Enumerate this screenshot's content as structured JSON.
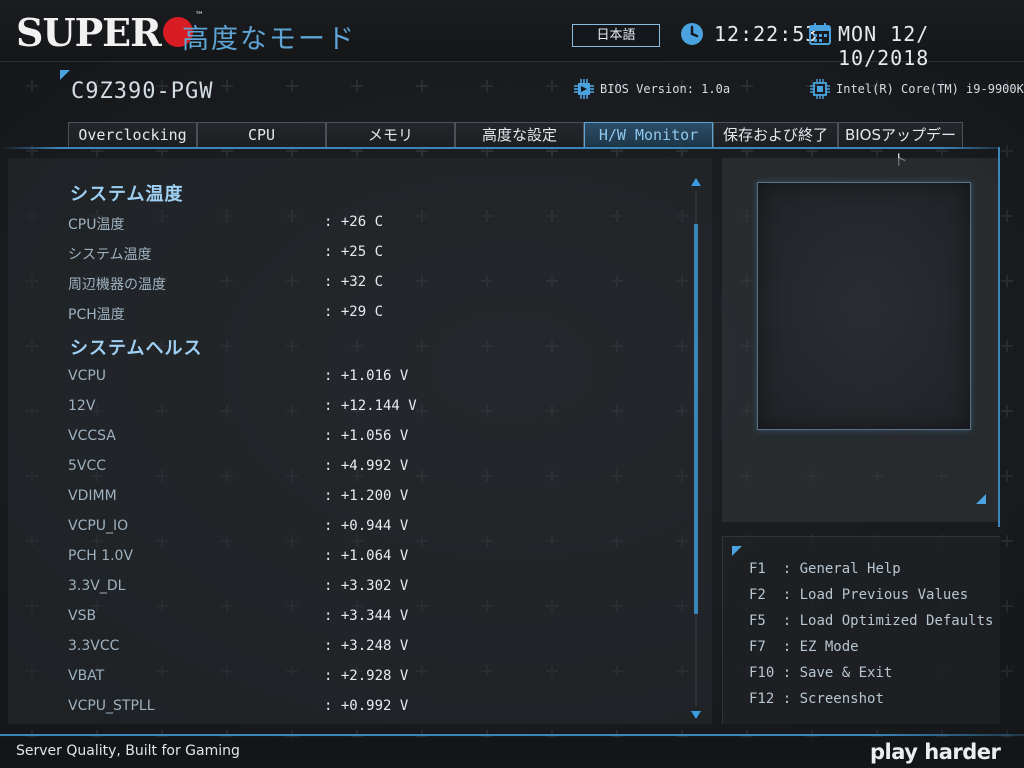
{
  "header": {
    "brand": "SUPER",
    "trademark": "™",
    "mode_title": "高度なモード",
    "language": "日本語",
    "time": "12:22:53",
    "date": "MON  12/ 10/2018"
  },
  "system": {
    "model": "C9Z390-PGW",
    "bios_version": "BIOS Version: 1.0a",
    "cpu": "Intel(R) Core(TM) i9-9900K"
  },
  "tabs": [
    {
      "label": "Overclocking",
      "active": false
    },
    {
      "label": "CPU",
      "active": false
    },
    {
      "label": "メモリ",
      "active": false
    },
    {
      "label": "高度な設定",
      "active": false
    },
    {
      "label": "H/W Monitor",
      "active": true
    },
    {
      "label": "保存および終了",
      "active": false
    },
    {
      "label": "BIOSアップデート",
      "active": false
    }
  ],
  "sections": {
    "temperature": {
      "title": "システム温度",
      "rows": [
        {
          "label": "CPU温度",
          "value": ": +26 C"
        },
        {
          "label": "システム温度",
          "value": ": +25 C"
        },
        {
          "label": "周辺機器の温度",
          "value": ": +32 C"
        },
        {
          "label": "PCH温度",
          "value": ": +29 C"
        }
      ]
    },
    "health": {
      "title": "システムヘルス",
      "rows": [
        {
          "label": "VCPU",
          "value": ": +1.016 V"
        },
        {
          "label": "12V",
          "value": ": +12.144 V"
        },
        {
          "label": "VCCSA",
          "value": ": +1.056 V"
        },
        {
          "label": "5VCC",
          "value": ": +4.992 V"
        },
        {
          "label": "VDIMM",
          "value": ": +1.200 V"
        },
        {
          "label": "VCPU_IO",
          "value": ": +0.944 V"
        },
        {
          "label": "PCH 1.0V",
          "value": ": +1.064 V"
        },
        {
          "label": "3.3V_DL",
          "value": ": +3.302 V"
        },
        {
          "label": "VSB",
          "value": ": +3.344 V"
        },
        {
          "label": "3.3VCC",
          "value": ": +3.248 V"
        },
        {
          "label": "VBAT",
          "value": ": +2.928 V"
        },
        {
          "label": "VCPU_STPLL",
          "value": ": +0.992 V"
        }
      ]
    }
  },
  "help": [
    {
      "key": "F1 ",
      "text": ": General Help"
    },
    {
      "key": "F2 ",
      "text": ": Load Previous Values"
    },
    {
      "key": "F5 ",
      "text": ": Load Optimized Defaults"
    },
    {
      "key": "F7 ",
      "text": ": EZ Mode"
    },
    {
      "key": "F10",
      "text": ": Save & Exit"
    },
    {
      "key": "F12",
      "text": ": Screenshot"
    }
  ],
  "footer": {
    "tagline": "Server Quality, Built for Gaming",
    "slogan": "play harder"
  },
  "colors": {
    "accent": "#4aa3df",
    "brand_red": "#d81c23",
    "background": "#1c1f23"
  },
  "icons": [
    "clock-icon",
    "calendar-icon",
    "chip-icon"
  ]
}
